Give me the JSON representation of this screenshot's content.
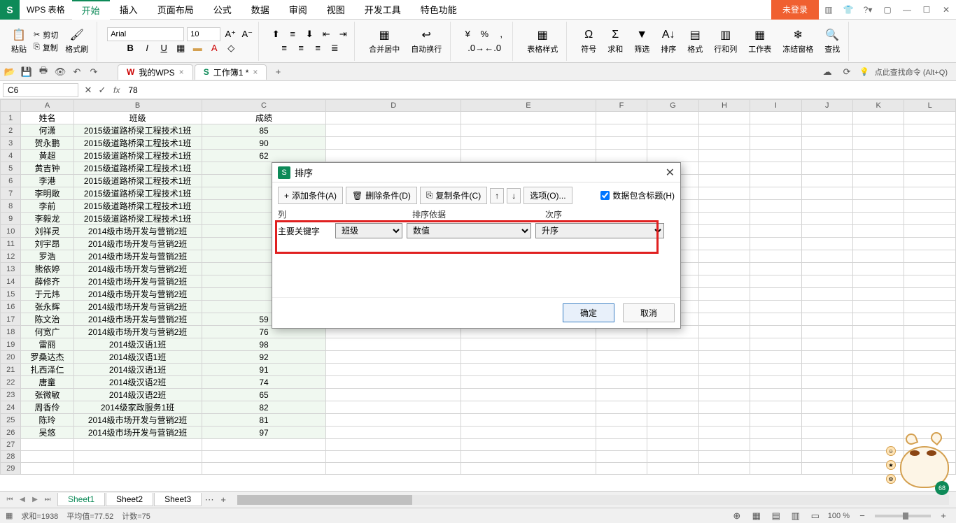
{
  "app": {
    "logo": "S",
    "name": "WPS 表格",
    "login": "未登录"
  },
  "menu": {
    "tabs": [
      "开始",
      "插入",
      "页面布局",
      "公式",
      "数据",
      "审阅",
      "视图",
      "开发工具",
      "特色功能"
    ],
    "active": 0
  },
  "ribbon": {
    "paste": "粘贴",
    "cut": "剪切",
    "copy": "复制",
    "fmt_painter": "格式刷",
    "font": "Arial",
    "size": "10",
    "merge": "合并居中",
    "wrap": "自动换行",
    "style": "表格样式",
    "symbol": "符号",
    "sum": "求和",
    "filter": "筛选",
    "sort": "排序",
    "format": "格式",
    "rowcol": "行和列",
    "worksheet": "工作表",
    "freeze": "冻结窗格",
    "find": "查找"
  },
  "quickbar": {
    "search_hint": "点此查找命令 (Alt+Q)"
  },
  "doc_tabs": [
    {
      "label": "我的WPS",
      "icon": "W"
    },
    {
      "label": "工作簿1 *",
      "icon": "S",
      "active": true
    }
  ],
  "formula": {
    "namebox": "C6",
    "fx": "fx",
    "value": "78"
  },
  "columns": [
    "A",
    "B",
    "C",
    "D",
    "E",
    "F",
    "G",
    "H",
    "I",
    "J",
    "K",
    "L"
  ],
  "headers": {
    "A": "姓名",
    "B": "班级",
    "C": "成绩"
  },
  "rows": [
    {
      "r": 2,
      "A": "何潇",
      "B": "2015级道路桥梁工程技术1班",
      "C": 85
    },
    {
      "r": 3,
      "A": "贺永鹏",
      "B": "2015级道路桥梁工程技术1班",
      "C": 90
    },
    {
      "r": 4,
      "A": "黄超",
      "B": "2015级道路桥梁工程技术1班",
      "C": 62
    },
    {
      "r": 5,
      "A": "黄吉钟",
      "B": "2015级道路桥梁工程技术1班",
      "C": ""
    },
    {
      "r": 6,
      "A": "李港",
      "B": "2015级道路桥梁工程技术1班",
      "C": ""
    },
    {
      "r": 7,
      "A": "李明敞",
      "B": "2015级道路桥梁工程技术1班",
      "C": ""
    },
    {
      "r": 8,
      "A": "李前",
      "B": "2015级道路桥梁工程技术1班",
      "C": ""
    },
    {
      "r": 9,
      "A": "李毅龙",
      "B": "2015级道路桥梁工程技术1班",
      "C": ""
    },
    {
      "r": 10,
      "A": "刘祥灵",
      "B": "2014级市场开发与营销2班",
      "C": ""
    },
    {
      "r": 11,
      "A": "刘宇昂",
      "B": "2014级市场开发与营销2班",
      "C": ""
    },
    {
      "r": 12,
      "A": "罗浩",
      "B": "2014级市场开发与营销2班",
      "C": ""
    },
    {
      "r": 13,
      "A": "熊依婷",
      "B": "2014级市场开发与营销2班",
      "C": ""
    },
    {
      "r": 14,
      "A": "薛修齐",
      "B": "2014级市场开发与营销2班",
      "C": ""
    },
    {
      "r": 15,
      "A": "于元炜",
      "B": "2014级市场开发与营销2班",
      "C": ""
    },
    {
      "r": 16,
      "A": "张永辉",
      "B": "2014级市场开发与营销2班",
      "C": ""
    },
    {
      "r": 17,
      "A": "陈文治",
      "B": "2014级市场开发与营销2班",
      "C": 59
    },
    {
      "r": 18,
      "A": "何宽广",
      "B": "2014级市场开发与营销2班",
      "C": 76
    },
    {
      "r": 19,
      "A": "雷丽",
      "B": "2014级汉语1班",
      "C": 98
    },
    {
      "r": 20,
      "A": "罗桑达杰",
      "B": "2014级汉语1班",
      "C": 92
    },
    {
      "r": 21,
      "A": "扎西泽仁",
      "B": "2014级汉语1班",
      "C": 91
    },
    {
      "r": 22,
      "A": "唐童",
      "B": "2014级汉语2班",
      "C": 74
    },
    {
      "r": 23,
      "A": "张微敏",
      "B": "2014级汉语2班",
      "C": 65
    },
    {
      "r": 24,
      "A": "周香伶",
      "B": "2014级家政服务1班",
      "C": 82
    },
    {
      "r": 25,
      "A": "陈玲",
      "B": "2014级市场开发与营销2班",
      "C": 81
    },
    {
      "r": 26,
      "A": "吴悠",
      "B": "2014级市场开发与营销2班",
      "C": 97
    }
  ],
  "empty_rows": [
    27,
    28,
    29
  ],
  "sheets": [
    "Sheet1",
    "Sheet2",
    "Sheet3"
  ],
  "active_sheet": 0,
  "status": {
    "sum": "求和=1938",
    "avg": "平均值=77.52",
    "count": "计数=75",
    "zoom": "100 %"
  },
  "dialog": {
    "title": "排序",
    "add": "添加条件(A)",
    "del": "删除条件(D)",
    "copy": "复制条件(C)",
    "options": "选项(O)...",
    "has_header": "数据包含标题(H)",
    "hdr_col": "列",
    "hdr_basis": "排序依据",
    "hdr_order": "次序",
    "row_label": "主要关键字",
    "col_val": "班级",
    "basis_val": "数值",
    "order_val": "升序",
    "ok": "确定",
    "cancel": "取消"
  }
}
